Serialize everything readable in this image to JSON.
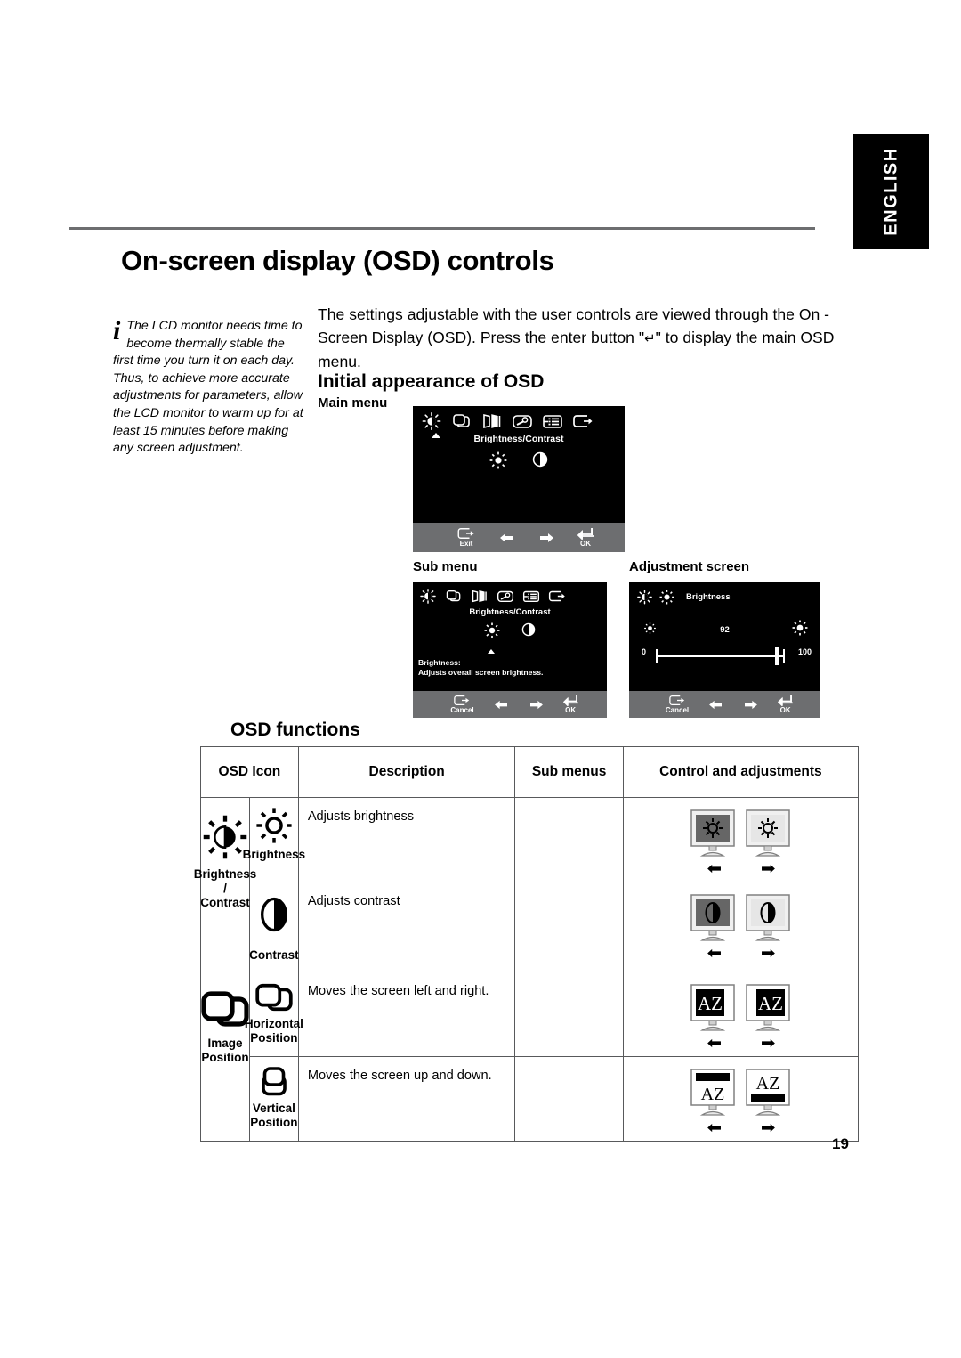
{
  "side_tab": {
    "label": "ENGLISH"
  },
  "page": {
    "title": "On-screen display (OSD) controls",
    "number": "19"
  },
  "note": {
    "icon": "info-icon",
    "text": "The LCD monitor needs time to become thermally stable the first time you turn it on each day. Thus, to achieve more accurate adjustments for parameters, allow the LCD monitor to warm up for  at least 15 minutes before making any screen adjustment."
  },
  "intro": {
    "part1": "The settings adjustable with the user controls are viewed through the On - Screen Display (OSD). Press the enter button \"",
    "enter_symbol": "↵",
    "part2": "\" to display the main OSD menu."
  },
  "headings": {
    "initial_appearance": "Initial appearance of OSD",
    "osd_functions": "OSD functions",
    "main_menu": "Main menu",
    "sub_menu": "Sub menu",
    "adjustment_screen": "Adjustment screen"
  },
  "osd_main": {
    "title": "Brightness/Contrast",
    "toolbar_icons": [
      "brightness-contrast-icon",
      "image-position-icon",
      "image-setup-icon",
      "image-properties-icon",
      "options-icon",
      "exit-icon"
    ],
    "row_icons": [
      "brightness-icon",
      "contrast-icon"
    ],
    "footer": [
      {
        "icon": "exit-icon",
        "label": "Exit"
      },
      {
        "icon": "left-arrow-icon",
        "label": ""
      },
      {
        "icon": "right-arrow-icon",
        "label": ""
      },
      {
        "icon": "enter-icon",
        "label": "OK"
      }
    ]
  },
  "osd_sub": {
    "title": "Brightness/Contrast",
    "toolbar_icons": [
      "brightness-contrast-icon",
      "image-position-icon",
      "image-setup-icon",
      "image-properties-icon",
      "options-icon",
      "exit-icon"
    ],
    "row_icons": [
      "brightness-icon",
      "contrast-icon"
    ],
    "description": "Brightness:\nAdjusts overall screen brightness.",
    "footer": [
      {
        "icon": "exit-icon",
        "label": "Cancel"
      },
      {
        "icon": "left-arrow-icon",
        "label": ""
      },
      {
        "icon": "right-arrow-icon",
        "label": ""
      },
      {
        "icon": "enter-icon",
        "label": "OK"
      }
    ]
  },
  "osd_adjust": {
    "name": "Brightness",
    "value": "92",
    "min": "0",
    "max": "100",
    "footer": [
      {
        "icon": "exit-icon",
        "label": "Cancel"
      },
      {
        "icon": "left-arrow-icon",
        "label": ""
      },
      {
        "icon": "right-arrow-icon",
        "label": ""
      },
      {
        "icon": "enter-icon",
        "label": "OK"
      }
    ]
  },
  "table": {
    "headers": [
      "OSD Icon",
      "Description",
      "Sub menus",
      "Control and adjustments"
    ],
    "groups": [
      {
        "label": "Brightness /\nContrast",
        "icon": "brightness-contrast-icon",
        "rows": [
          {
            "sub_icon": "brightness-icon",
            "sub_label": "Brightness",
            "description": "Adjusts brightness",
            "sub_menus": "",
            "control_icons": "brightness-monitor-pair"
          },
          {
            "sub_icon": "contrast-icon",
            "sub_label": "Contrast",
            "description": "Adjusts contrast",
            "sub_menus": "",
            "control_icons": "contrast-monitor-pair"
          }
        ]
      },
      {
        "label": "Image\nPosition",
        "icon": "image-position-icon",
        "rows": [
          {
            "sub_icon": "horizontal-position-icon",
            "sub_label": "Horizontal\nPosition",
            "description": "Moves the screen left and right.",
            "sub_menus": "",
            "control_icons": "hpos-monitor-pair"
          },
          {
            "sub_icon": "vertical-position-icon",
            "sub_label": "Vertical\nPosition",
            "description": "Moves the screen up and down.",
            "sub_menus": "",
            "control_icons": "vpos-monitor-pair"
          }
        ]
      }
    ]
  }
}
